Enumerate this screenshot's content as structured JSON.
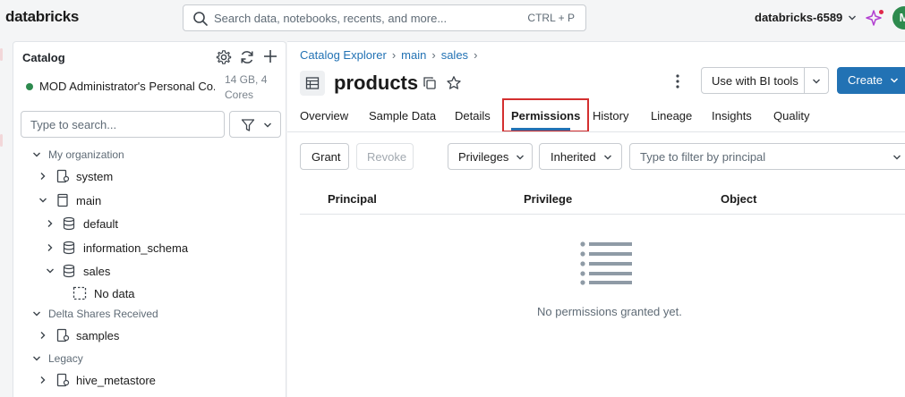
{
  "topbar": {
    "logo": "databricks",
    "search_placeholder": "Search data, notebooks, recents, and more...",
    "search_shortcut": "CTRL + P",
    "workspace": "databricks-6589",
    "avatar_initial": "M"
  },
  "sidebar": {
    "title": "Catalog",
    "cluster_name": "MOD Administrator's Personal Co...",
    "cluster_resources": "14 GB, 4 Cores",
    "search_placeholder": "Type to search...",
    "groups": {
      "my_org": "My organization",
      "delta_shares": "Delta Shares Received",
      "legacy": "Legacy"
    },
    "items": {
      "system": "system",
      "main": "main",
      "default": "default",
      "information_schema": "information_schema",
      "sales": "sales",
      "no_data": "No data",
      "samples": "samples",
      "hive_metastore": "hive_metastore"
    }
  },
  "main": {
    "breadcrumb": [
      "Catalog Explorer",
      "main",
      "sales"
    ],
    "title": "products",
    "bi_tools_label": "Use with BI tools",
    "create_label": "Create",
    "tabs": [
      "Overview",
      "Sample Data",
      "Details",
      "Permissions",
      "History",
      "Lineage",
      "Insights",
      "Quality"
    ],
    "active_tab": "Permissions",
    "grant_label": "Grant",
    "revoke_label": "Revoke",
    "privileges_label": "Privileges",
    "inherited_label": "Inherited",
    "principal_filter_placeholder": "Type to filter by principal",
    "columns": [
      "Principal",
      "Privilege",
      "Object"
    ],
    "empty_message": "No permissions granted yet."
  },
  "colors": {
    "accent": "#2272b4",
    "highlight": "#d32f2f",
    "status_running": "#2d8a4e"
  }
}
